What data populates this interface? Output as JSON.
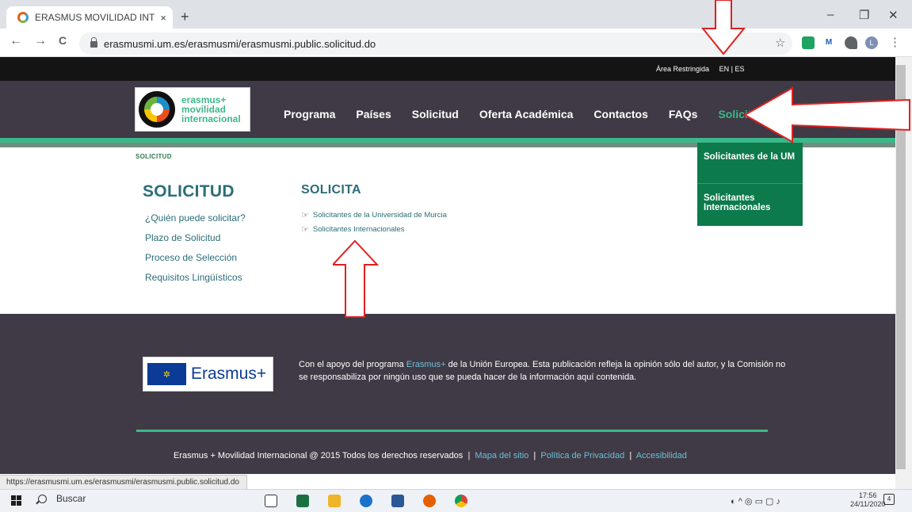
{
  "browser": {
    "tab_title": "ERASMUS MOVILIDAD INTERNA(",
    "tab_close": "×",
    "new_tab": "+",
    "window_controls": {
      "minimize": "–",
      "maximize": "❐",
      "close": "✕"
    },
    "nav": {
      "back": "←",
      "forward": "→",
      "reload": "C"
    },
    "url": "erasmusmi.um.es/erasmusmi/erasmusmi.public.solicitud.do",
    "star": "☆",
    "avatar_letter": "L",
    "menu": "⋮",
    "status_url": "https://erasmusmi.um.es/erasmusmi/erasmusmi.public.solicitud.do"
  },
  "site": {
    "top_links": {
      "restricted": "Área Restringida",
      "en": "EN",
      "sep": "|",
      "es": "ES"
    },
    "logo": {
      "line1": "erasmus+",
      "line2": "movilidad",
      "line3": "internacional"
    },
    "nav": [
      "Programa",
      "Países",
      "Solicitud",
      "Oferta Académica",
      "Contactos",
      "FAQs",
      "Solicita"
    ],
    "dropdown": [
      "Solicitantes de la UM",
      "Solicitantes Internacionales"
    ],
    "breadcrumb": "Solicitud",
    "side_title": "SOLICITUD",
    "side_links": [
      "¿Quién puede solicitar?",
      "Plazo de Solicitud",
      "Proceso de Selección",
      "Requisitos Lingüísticos"
    ],
    "main_title": "SOLICITA",
    "main_links": [
      "Solicitantes de la Universidad de Murcia",
      "Solicitantes Internacionales"
    ],
    "hand_icon": "☞",
    "footer": {
      "eu_logo_text": "Erasmus+",
      "support_pre": "Con el apoyo del programa ",
      "support_link": "Erasmus+",
      "support_post": " de la Unión Europea. Esta publicación refleja la opinión sólo del autor, y la Comisión no se responsabiliza por ningún uso que se pueda hacer de la información aquí contenida.",
      "copyright": "Erasmus + Movilidad Internacional @ 2015 Todos los derechos reservados",
      "sep": "|",
      "links": [
        "Mapa del sitio",
        "Política de Privacidad",
        "Accesibilidad"
      ]
    }
  },
  "taskbar": {
    "search": "Buscar",
    "time": "17:56",
    "date": "24/11/2020",
    "notifications": "4"
  },
  "colors": {
    "accent": "#3cb88a",
    "header": "#3f3a45",
    "link": "#2b6d78",
    "annotation": "#e02020"
  }
}
